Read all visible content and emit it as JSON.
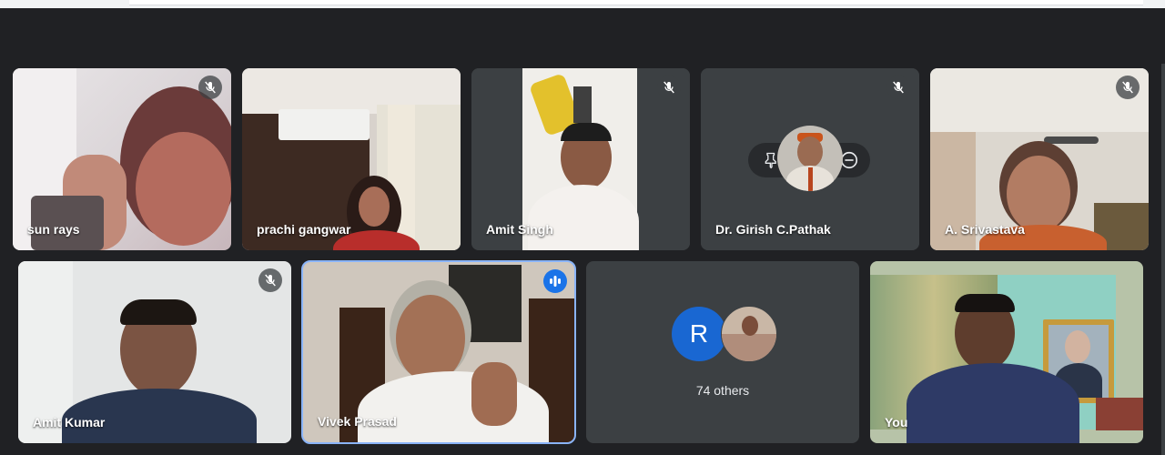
{
  "participants": [
    {
      "name": "sun rays",
      "muted": true
    },
    {
      "name": "prachi gangwar",
      "muted": false
    },
    {
      "name": "Amit Singh",
      "muted": true
    },
    {
      "name": "Dr. Girish C.Pathak",
      "muted": true
    },
    {
      "name": "A. Srivastava",
      "muted": true
    },
    {
      "name": "Amit Kumar",
      "muted": true
    },
    {
      "name": "Vivek Prasad",
      "speaking": true
    },
    {
      "name": "You",
      "muted": false
    }
  ],
  "others": {
    "avatar_letter": "R",
    "label": "74 others"
  },
  "colors": {
    "background": "#202124",
    "tile": "#3c4043",
    "speaking_outline": "#8ab4f8",
    "speaking_badge": "#1a73e8",
    "avatar_blue": "#1967d2"
  }
}
